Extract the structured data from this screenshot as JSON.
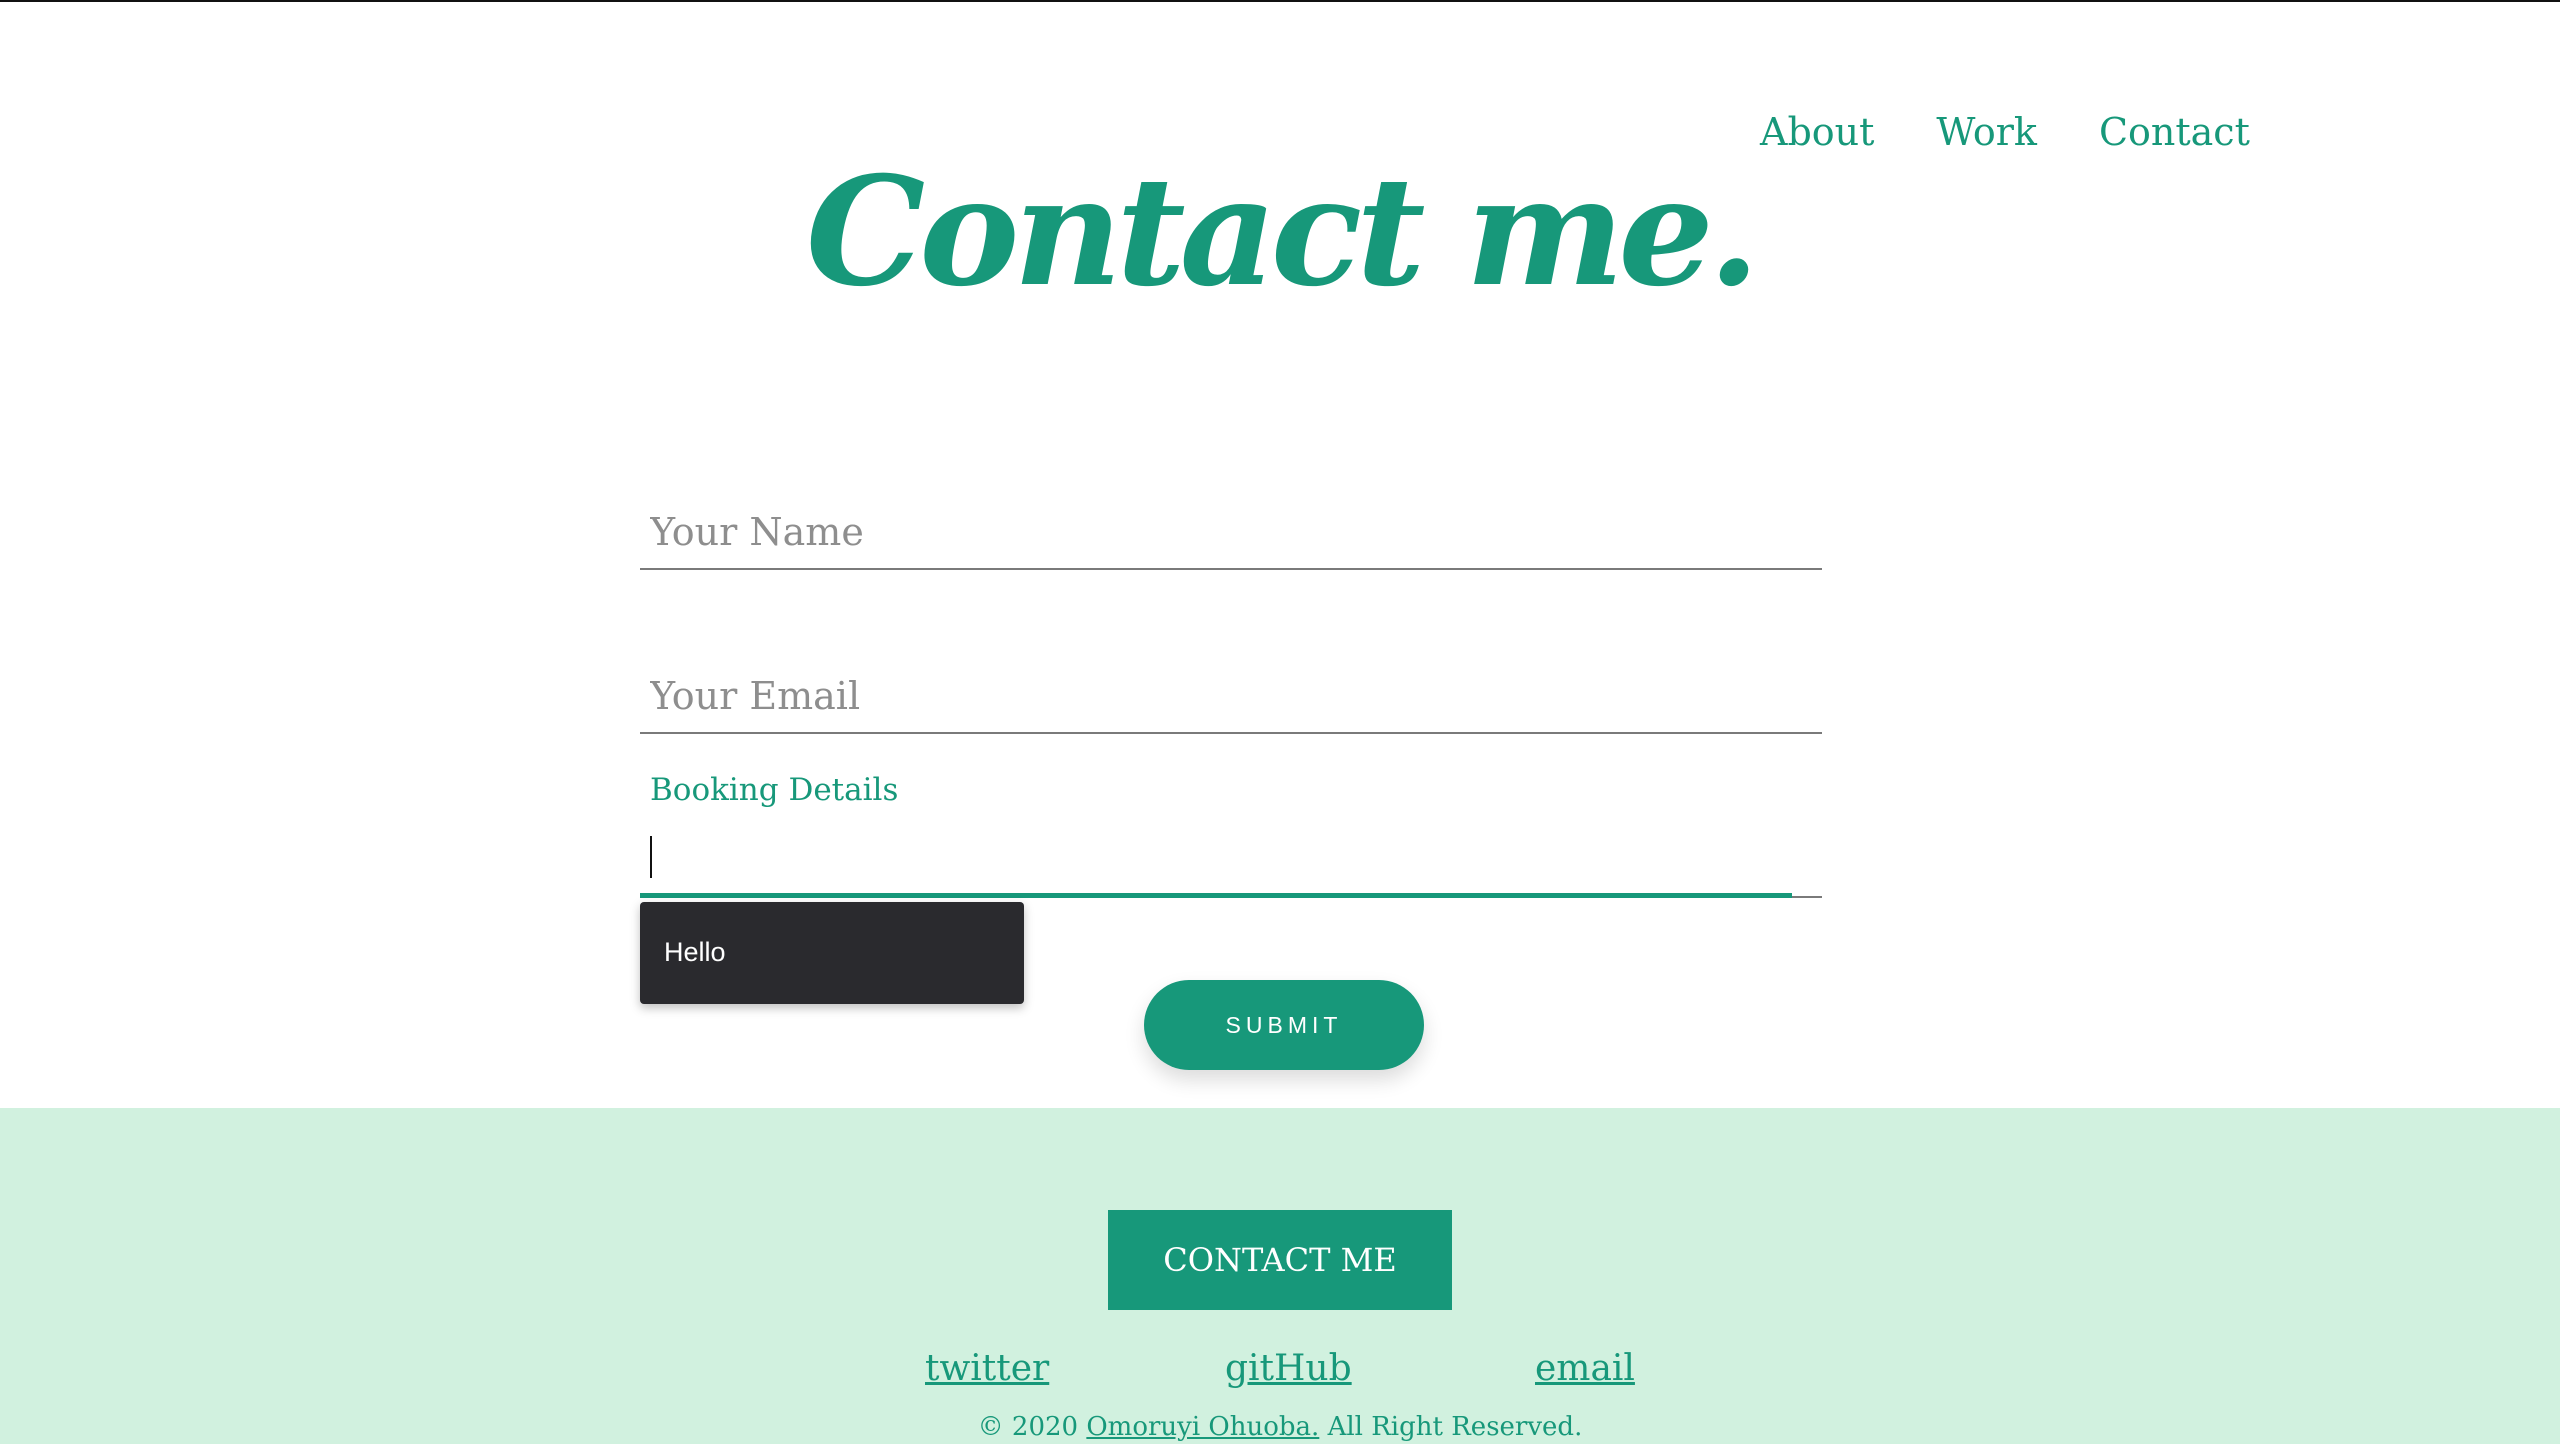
{
  "nav": {
    "items": [
      {
        "label": "About"
      },
      {
        "label": "Work"
      },
      {
        "label": "Contact"
      }
    ]
  },
  "page_title": "Contact me.",
  "form": {
    "name_placeholder": "Your Name",
    "email_placeholder": "Your Email",
    "booking_label": "Booking Details",
    "booking_value": "",
    "autocomplete_suggestion": "Hello",
    "submit_label": "SUBMIT"
  },
  "footer": {
    "contact_button_label": "CONTACT ME",
    "social": {
      "twitter": "twitter",
      "github": "gitHub",
      "email": "email"
    },
    "copyright_prefix": "© 2020",
    "copyright_name": "Omoruyi Ohuoba.",
    "copyright_suffix": "All Right Reserved."
  },
  "colors": {
    "accent": "#17987a",
    "footer_bg": "#d1f1df",
    "autocomplete_bg": "#2a2a2e"
  }
}
